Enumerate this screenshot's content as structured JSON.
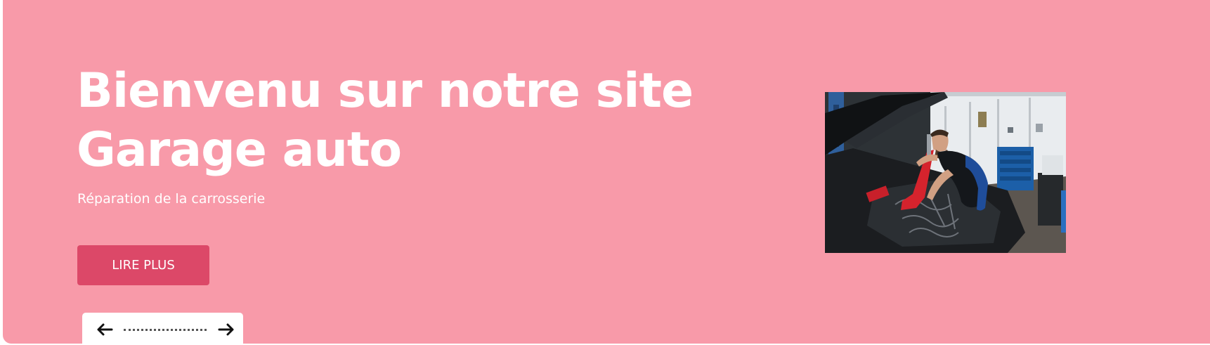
{
  "hero": {
    "title_line1": "Bienvenu sur notre site",
    "title_line2": "Garage auto",
    "subtitle": "Réparation de la carrosserie",
    "cta_label": "LIRE PLUS",
    "image_icon": "mechanic-photo",
    "colors": {
      "background": "#f89aa9",
      "button": "#dc4868",
      "text": "#ffffff"
    }
  },
  "slider_nav": {
    "prev_icon": "arrow-left-icon",
    "next_icon": "arrow-right-icon"
  }
}
